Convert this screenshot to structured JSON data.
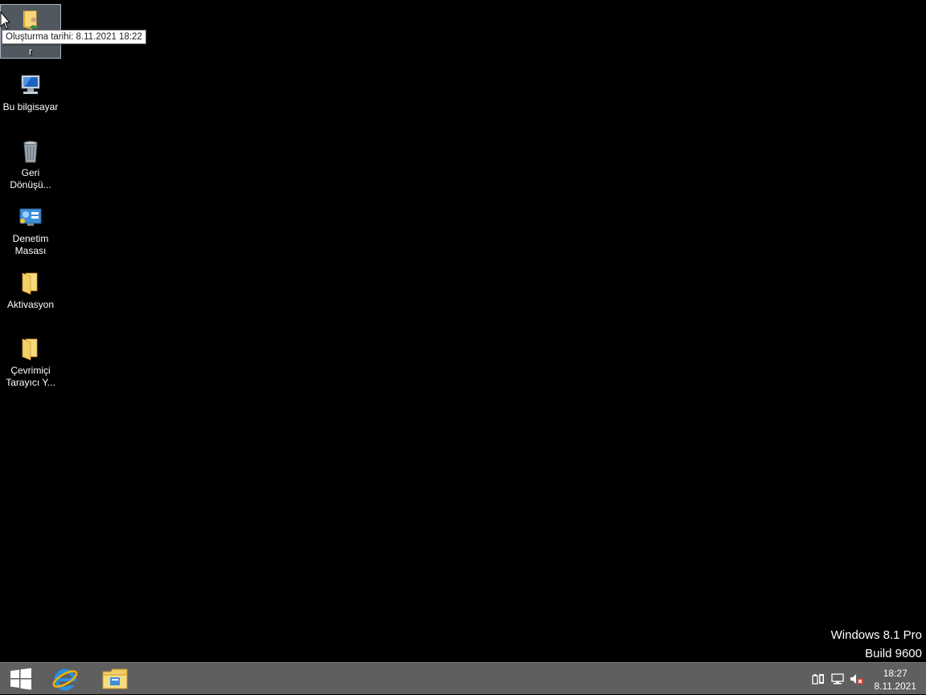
{
  "desktop": {
    "icons": [
      {
        "label": "r",
        "icon": "user-folder-icon",
        "selected": true
      },
      {
        "label": "Bu bilgisayar",
        "icon": "computer-icon"
      },
      {
        "label": "Geri Dönüşü...",
        "icon": "recycle-bin-icon"
      },
      {
        "label": "Denetim Masası",
        "icon": "control-panel-icon"
      },
      {
        "label": "Aktivasyon",
        "icon": "folder-icon"
      },
      {
        "label": "Çevrimiçi Tarayıcı Y...",
        "icon": "folder-icon"
      }
    ],
    "tooltip": "Oluşturma tarihi: 8.11.2021 18:22"
  },
  "watermark": {
    "edition": "Windows 8.1 Pro",
    "build": "Build 9600"
  },
  "taskbar": {
    "start": "windows-logo-icon",
    "pinned": [
      {
        "name": "internet-explorer-icon"
      },
      {
        "name": "file-explorer-icon"
      }
    ],
    "tray": [
      {
        "name": "power-icon"
      },
      {
        "name": "network-icon"
      },
      {
        "name": "volume-muted-icon"
      }
    ],
    "clock": {
      "time": "18:27",
      "date": "8.11.2021"
    }
  },
  "colors": {
    "desktop_bg": "#000000",
    "taskbar_bg": "#5f5f5f",
    "folder_yellow": "#f3cf6a"
  }
}
